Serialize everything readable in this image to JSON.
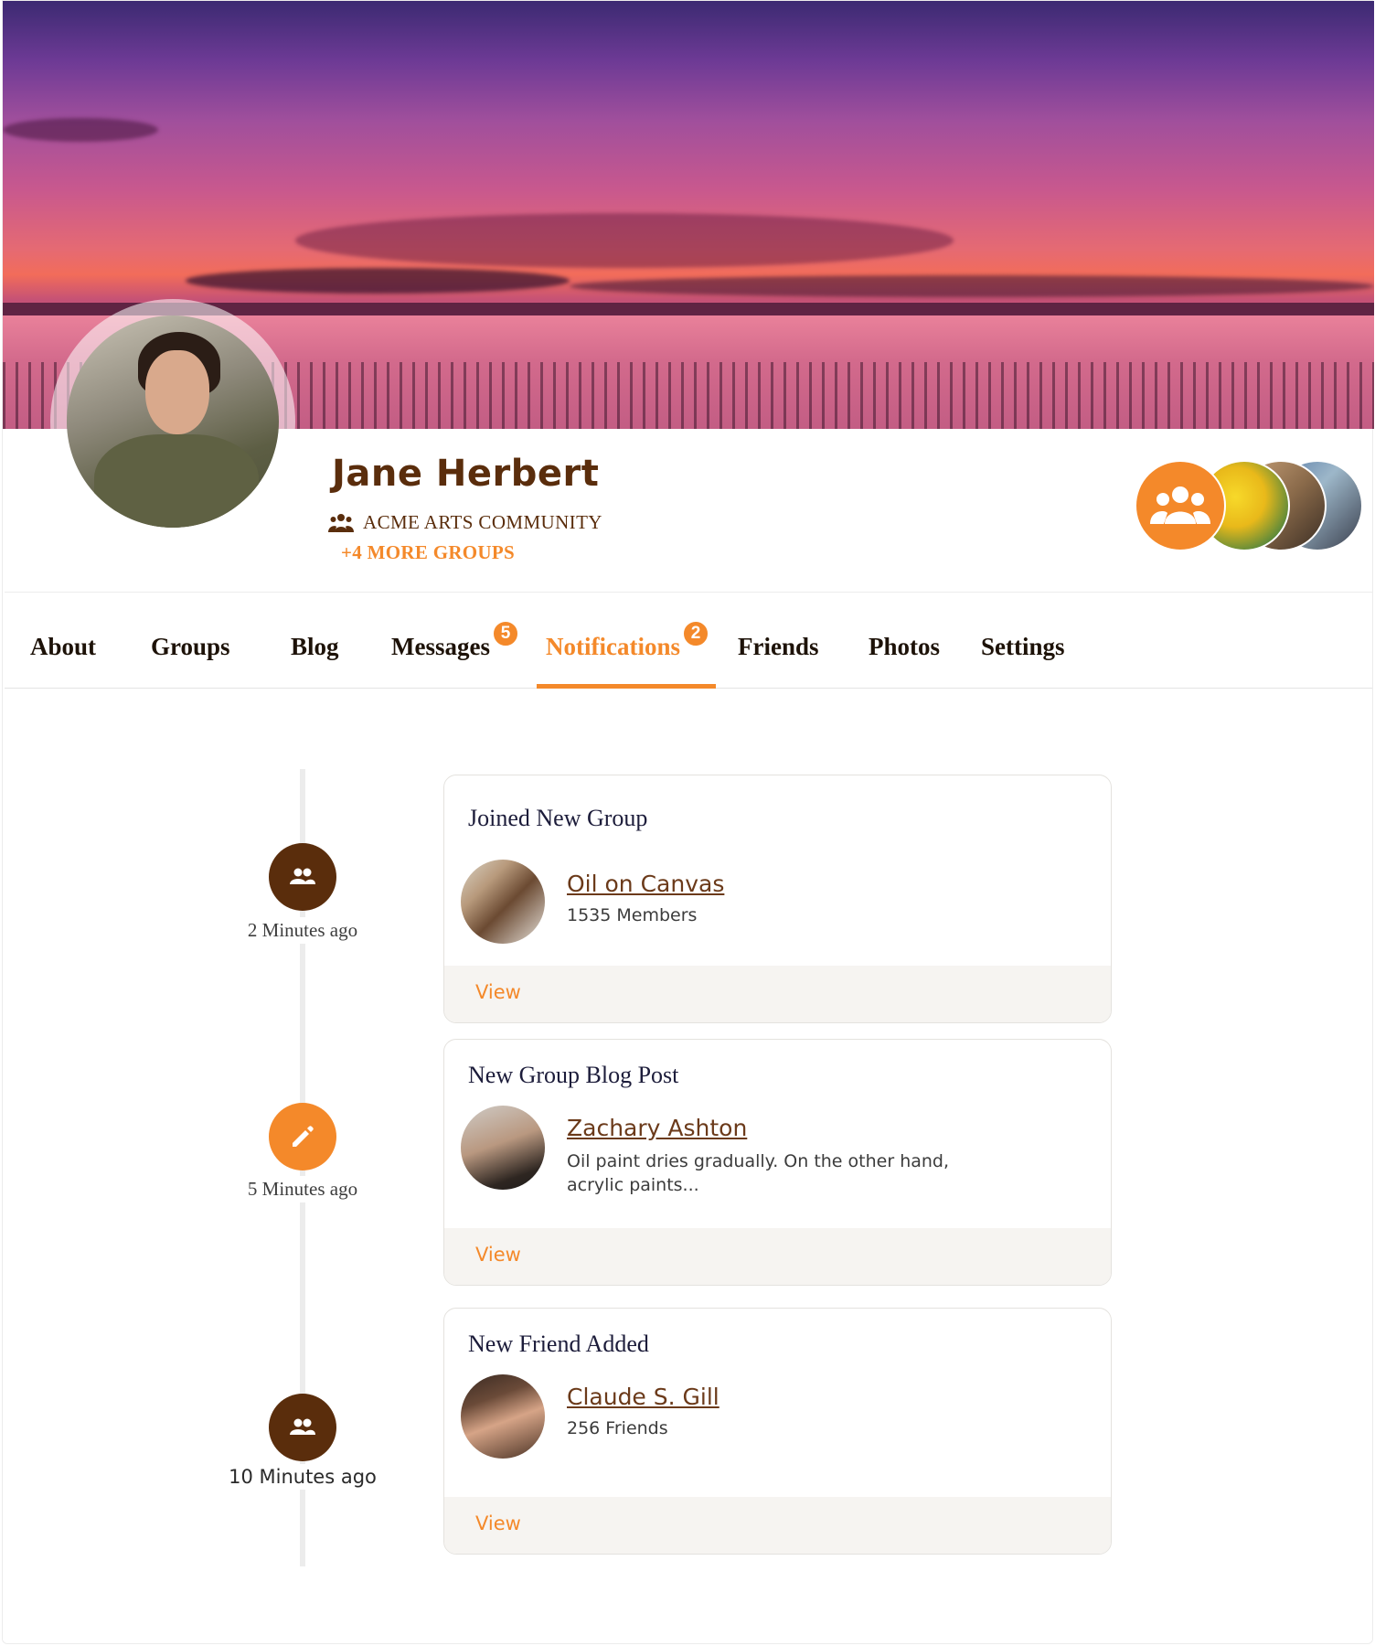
{
  "profile": {
    "name": "Jane Herbert",
    "group": "ACME ARTS COMMUNITY",
    "more_groups": "+4 MORE GROUPS"
  },
  "tabs": [
    {
      "label": "About"
    },
    {
      "label": "Groups"
    },
    {
      "label": "Blog"
    },
    {
      "label": "Messages",
      "badge": "5"
    },
    {
      "label": "Notifications",
      "badge": "2",
      "active": true
    },
    {
      "label": "Friends"
    },
    {
      "label": "Photos"
    },
    {
      "label": "Settings"
    }
  ],
  "notifications": [
    {
      "time": "2 Minutes ago",
      "icon": "group-icon",
      "title": "Joined New Group",
      "link": "Oil on Canvas",
      "sub": "1535 Members",
      "action": "View"
    },
    {
      "time": "5 Minutes ago",
      "icon": "pencil-icon",
      "title": "New Group Blog Post",
      "link": "Zachary Ashton",
      "sub": "Oil paint dries gradually. On the other hand, acrylic paints...",
      "action": "View"
    },
    {
      "time": "10 Minutes ago",
      "icon": "group-icon",
      "title": "New Friend Added",
      "link": "Claude S. Gill",
      "sub": "256 Friends",
      "action": "View"
    }
  ],
  "colors": {
    "accent": "#f4892a",
    "brand_brown": "#5a2d0c"
  }
}
